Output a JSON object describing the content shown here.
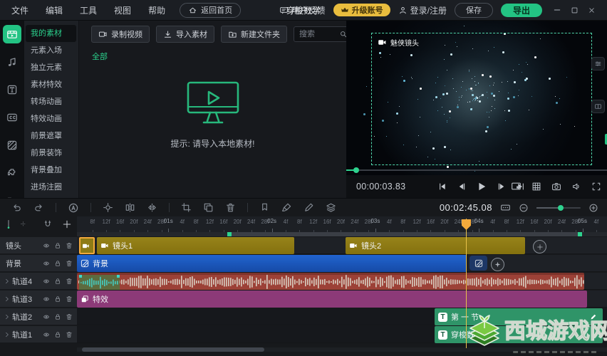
{
  "window": {
    "title": "穿梭数学",
    "controls": {
      "minimize": "minimize",
      "maximize": "maximize",
      "close": "close"
    }
  },
  "menubar": {
    "items": [
      "文件",
      "编辑",
      "工具",
      "视图",
      "帮助"
    ],
    "home": "返回首页"
  },
  "account": {
    "feedback": "用户反馈",
    "upgrade": "升级账号",
    "login": "登录/注册",
    "save": "保存",
    "export": "导出"
  },
  "sidebar": {
    "rail_icons": [
      "media-library-icon",
      "music-icon",
      "text-icon",
      "captions-icon",
      "overlay-icon",
      "plugin-icon",
      "folder-icon"
    ],
    "active_index": 0,
    "items": [
      "我的素材",
      "元素入场",
      "独立元素",
      "素材特效",
      "转场动画",
      "特效动画",
      "前景遮罩",
      "前景装饰",
      "背景叠加",
      "进场注圈"
    ]
  },
  "media_panel": {
    "buttons": {
      "record": "录制视频",
      "import": "导入素材",
      "new_folder": "新建文件夹"
    },
    "search_placeholder": "搜索",
    "category_tab": "全部",
    "empty_tip": "提示: 请导入本地素材!"
  },
  "preview": {
    "clip_label": "魅侠镜头",
    "current_time": "00:00:03.83"
  },
  "edit_toolbar": {
    "timecode": "00:02:45.08"
  },
  "timeline": {
    "ruler": {
      "fps": 30,
      "frame_step_labels": [
        "4f",
        "8f",
        "12f",
        "16f",
        "20f",
        "24f",
        "28f"
      ],
      "second_labels": [
        "01s",
        "02s",
        "03s",
        "04s",
        "05s"
      ]
    },
    "tracks": [
      {
        "name": "镜头",
        "type": "video",
        "clips": [
          {
            "label": ""
          },
          {
            "label": "镜头1"
          },
          {
            "label": "镜头2"
          }
        ]
      },
      {
        "name": "背景",
        "type": "video",
        "clips": [
          {
            "label": "背景"
          }
        ]
      },
      {
        "name": "轨道4",
        "type": "audio",
        "clips": [
          {
            "label": ""
          }
        ]
      },
      {
        "name": "轨道3",
        "type": "effect",
        "clips": [
          {
            "label": "特效"
          }
        ]
      },
      {
        "name": "轨道2",
        "type": "text",
        "clips": [
          {
            "label": "第 一 节"
          }
        ]
      },
      {
        "name": "轨道1",
        "type": "text",
        "clips": [
          {
            "label": "穿梭数学"
          }
        ]
      }
    ]
  },
  "watermark": {
    "text": "西城游戏网"
  },
  "colors": {
    "accent": "#23c383",
    "yellow": "#e9bd3e",
    "olive": "#8e7b15",
    "blue": "#1b58be",
    "red": "#9c4137",
    "purple": "#8c3a78",
    "green": "#2f9468",
    "playhead": "#f2a93c",
    "dash": "#4fd6ab"
  }
}
